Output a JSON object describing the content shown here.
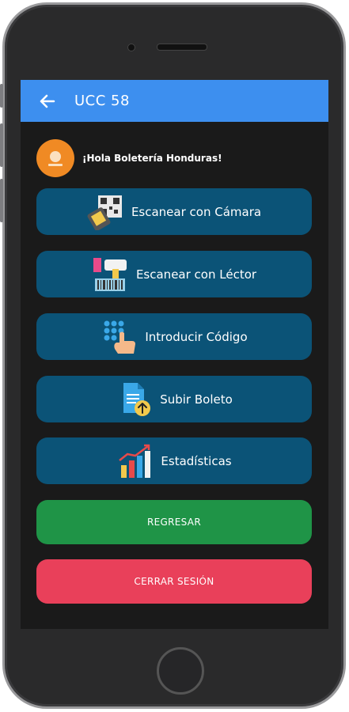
{
  "appbar": {
    "title": "UCC 58"
  },
  "greeting": {
    "text": "¡Hola Boletería Honduras!"
  },
  "menu": [
    {
      "label": "Escanear con Cámara",
      "icon": "qr-camera-scan-icon"
    },
    {
      "label": "Escanear con Léctor",
      "icon": "barcode-reader-icon"
    },
    {
      "label": "Introducir Código",
      "icon": "keypad-hand-icon"
    },
    {
      "label": "Subir Boleto",
      "icon": "upload-document-icon"
    },
    {
      "label": "Estadísticas",
      "icon": "bar-chart-icon"
    }
  ],
  "actions": {
    "back": {
      "label": "REGRESAR",
      "color": "#1f9447"
    },
    "logout": {
      "label": "CERRAR SESIÓN",
      "color": "#e9405a"
    }
  },
  "colors": {
    "appbar": "#3d8fef",
    "menu_button": "#0b5377",
    "screen_background": "#1a1a1a",
    "avatar": "#f08a24"
  }
}
